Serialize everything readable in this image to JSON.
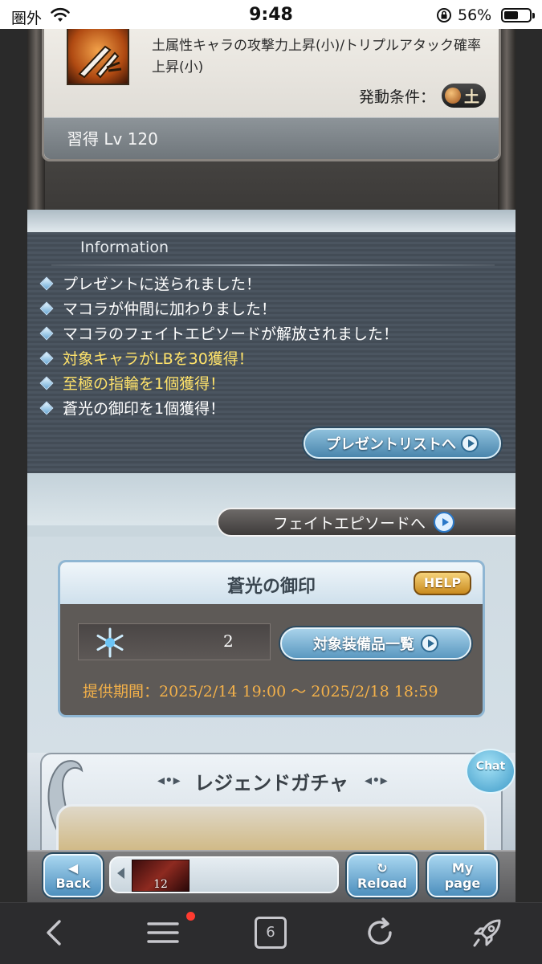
{
  "status_bar": {
    "carrier": "圏外",
    "time": "9:48",
    "battery_percent": "56%",
    "battery_level": 0.56
  },
  "ability": {
    "description": "土属性キャラの攻撃力上昇(小)/トリプルアタック確率上昇(小)",
    "condition_label": "発動条件：",
    "condition_element": "土",
    "learn_level": "習得 Lv 120"
  },
  "information": {
    "title": "Information",
    "items": [
      {
        "text": "プレゼントに送られました！",
        "highlight": false
      },
      {
        "text": "マコラが仲間に加わりました！",
        "highlight": false
      },
      {
        "text": "マコラのフェイトエピソードが解放されました！",
        "highlight": false
      },
      {
        "text": "対象キャラがLBを30獲得！",
        "highlight": true
      },
      {
        "text": "至極の指輪を1個獲得！",
        "highlight": true
      },
      {
        "text": "蒼光の御印を1個獲得！",
        "highlight": false
      }
    ],
    "present_list_button": "プレゼントリストへ"
  },
  "fate_episode_button": "フェイトエピソードへ",
  "seal": {
    "title": "蒼光の御印",
    "help": "HELP",
    "count": "2",
    "equipment_list_button": "対象装備品一覧",
    "period_label": "提供期間：",
    "period_value": "2025/2/14 19:00 〜 2025/2/18 18:59"
  },
  "gacha": {
    "title": "レジェンドガチャ"
  },
  "chat_button": "Chat",
  "game_toolbar": {
    "back": "Back",
    "recent_count": "12",
    "reload": "Reload",
    "mypage_line1": "My",
    "mypage_line2": "page"
  },
  "browser_toolbar": {
    "tab_count": "6"
  },
  "colors": {
    "highlight_text": "#ffe36a",
    "button_blue": "#4d8fbd",
    "period_orange": "#f2b04a"
  }
}
